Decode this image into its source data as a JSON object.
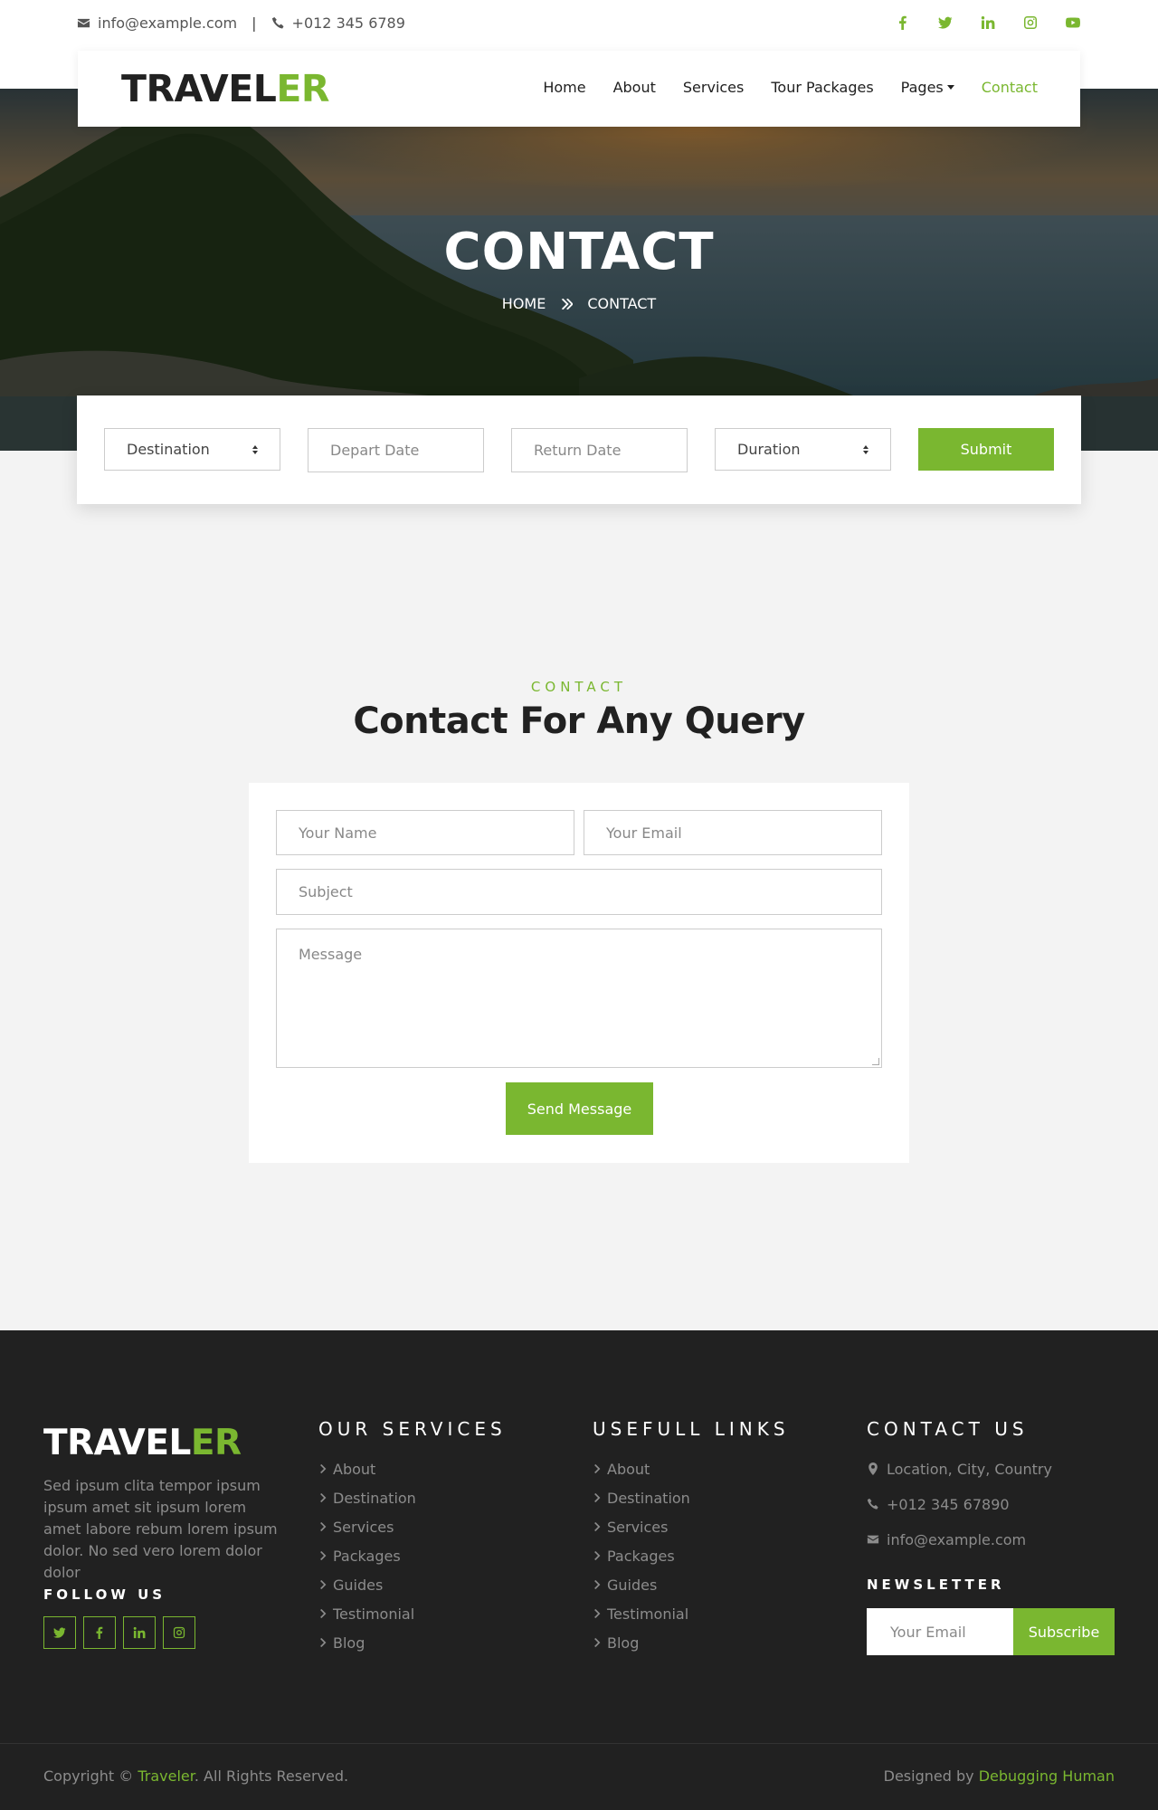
{
  "topbar": {
    "email": "info@example.com",
    "separator": "|",
    "phone": "+012 345 6789"
  },
  "navbar": {
    "brand_main": "TRAVEL",
    "brand_accent": "ER",
    "items": [
      {
        "label": "Home"
      },
      {
        "label": "About"
      },
      {
        "label": "Services"
      },
      {
        "label": "Tour Packages"
      },
      {
        "label": "Pages"
      },
      {
        "label": "Contact"
      }
    ]
  },
  "hero": {
    "title": "CONTACT",
    "crumb_home": "HOME",
    "crumb_current": "CONTACT"
  },
  "booking": {
    "destination": "Destination",
    "depart_placeholder": "Depart Date",
    "return_placeholder": "Return Date",
    "duration": "Duration",
    "submit": "Submit"
  },
  "contact": {
    "label": "CONTACT",
    "title": "Contact For Any Query",
    "name_placeholder": "Your Name",
    "email_placeholder": "Your Email",
    "subject_placeholder": "Subject",
    "message_placeholder": "Message",
    "send": "Send Message"
  },
  "footer": {
    "brand_main": "TRAVEL",
    "brand_accent": "ER",
    "about": "Sed ipsum clita tempor ipsum ipsum amet sit ipsum lorem amet labore rebum lorem ipsum dolor. No sed vero lorem dolor dolor",
    "follow": "FOLLOW US",
    "services_title": "OUR SERVICES",
    "services": [
      "About",
      "Destination",
      "Services",
      "Packages",
      "Guides",
      "Testimonial",
      "Blog"
    ],
    "links_title": "USEFULL LINKS",
    "links": [
      "About",
      "Destination",
      "Services",
      "Packages",
      "Guides",
      "Testimonial",
      "Blog"
    ],
    "contact_title": "CONTACT US",
    "location": "Location, City, Country",
    "phone": "+012 345 67890",
    "email": "info@example.com",
    "newsletter": "NEWSLETTER",
    "newsletter_placeholder": "Your Email",
    "subscribe": "Subscribe",
    "copy_prefix": "Copyright © ",
    "copy_brand": "Traveler",
    "copy_suffix": ". All Rights Reserved.",
    "design_prefix": "Designed by ",
    "design_by": "Debugging Human"
  },
  "colors": {
    "accent": "#7ab730",
    "dark": "#212121",
    "light_bg": "#f3f3f3"
  }
}
